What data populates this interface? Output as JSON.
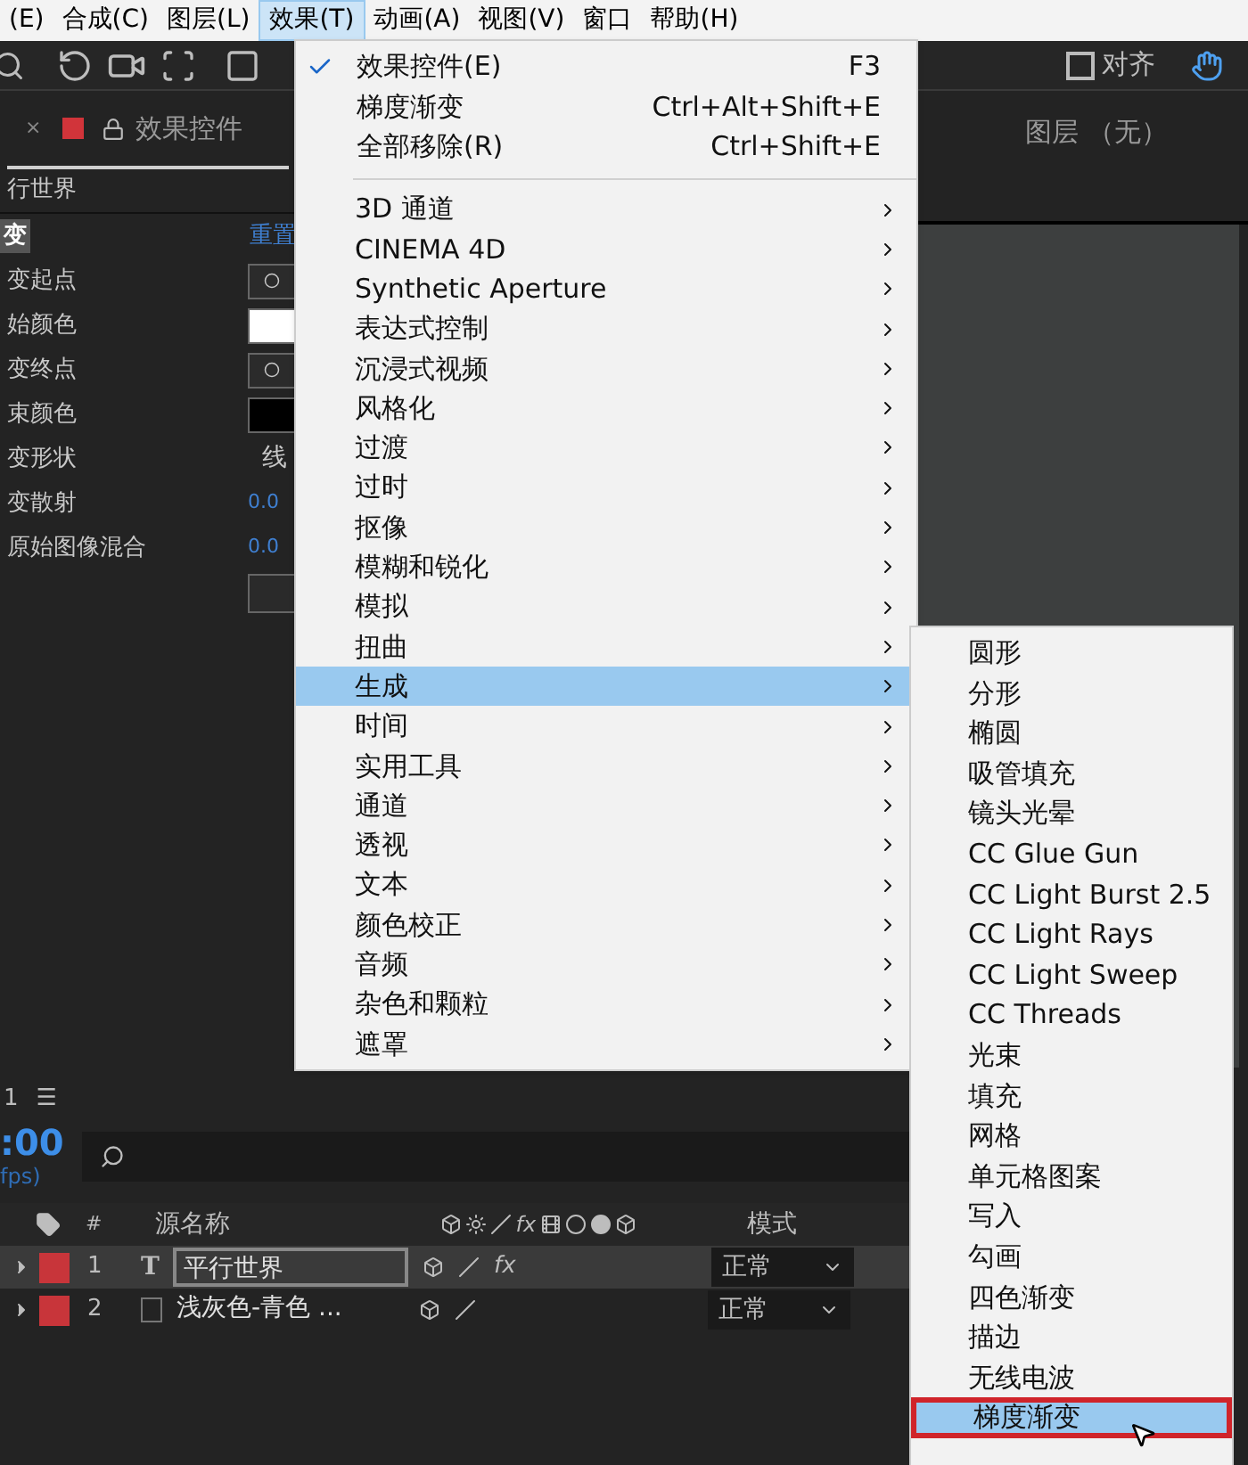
{
  "menubar": [
    {
      "label": "(E)",
      "selected": false
    },
    {
      "label": "合成(C)",
      "selected": false
    },
    {
      "label": "图层(L)",
      "selected": false
    },
    {
      "label": "效果(T)",
      "selected": true
    },
    {
      "label": "动画(A)",
      "selected": false
    },
    {
      "label": "视图(V)",
      "selected": false
    },
    {
      "label": "窗口",
      "selected": false
    },
    {
      "label": "帮助(H)",
      "selected": false
    }
  ],
  "toolbar": {
    "align_label": "对齐",
    "align_checked": false
  },
  "effect_panel": {
    "close_glyph": "×",
    "tab_label": "效果控件",
    "layer_name": "行世界",
    "effect_name": "变",
    "reset_label": "重置",
    "properties": [
      {
        "label": "变起点",
        "kind": "point"
      },
      {
        "label": "始颜色",
        "kind": "color",
        "color": "#ffffff"
      },
      {
        "label": "变终点",
        "kind": "point"
      },
      {
        "label": "束颜色",
        "kind": "color",
        "color": "#000000"
      },
      {
        "label": "变形状",
        "kind": "text",
        "value": "线"
      },
      {
        "label": "变散射",
        "kind": "number",
        "value": "0.0"
      },
      {
        "label": "原始图像混合",
        "kind": "number",
        "value": "0.0"
      },
      {
        "kind": "button"
      }
    ]
  },
  "right_panel": {
    "title": "图层 （无）"
  },
  "timeline": {
    "fx_header": "fx",
    "tab_label": "1",
    "menu_glyph": "☰",
    "timecode": ":00",
    "fps": "fps)",
    "hash_label": "#",
    "name_label": "源名称",
    "mode_label": "模式",
    "layers": [
      {
        "number": "1",
        "kind": "text",
        "type_glyph": "T",
        "fx_label": "fx",
        "name": "平行世界",
        "mode": "正常",
        "color": "#c8353a",
        "selected": true
      },
      {
        "number": "2",
        "kind": "solid",
        "name": "浅灰色-青色 ...",
        "mode": "正常",
        "color": "#c8353a",
        "selected": false
      }
    ]
  },
  "effects_menu": {
    "top_items": [
      {
        "label": "效果控件(E)",
        "shortcut": "F3",
        "checked": true
      },
      {
        "label": "梯度渐变",
        "shortcut": "Ctrl+Alt+Shift+E",
        "checked": false
      },
      {
        "label": "全部移除(R)",
        "shortcut": "Ctrl+Shift+E",
        "checked": false
      }
    ],
    "categories": [
      {
        "label": "3D 通道",
        "selected": false
      },
      {
        "label": "CINEMA 4D",
        "selected": false
      },
      {
        "label": "Synthetic Aperture",
        "selected": false
      },
      {
        "label": "表达式控制",
        "selected": false
      },
      {
        "label": "沉浸式视频",
        "selected": false
      },
      {
        "label": "风格化",
        "selected": false
      },
      {
        "label": "过渡",
        "selected": false
      },
      {
        "label": "过时",
        "selected": false
      },
      {
        "label": "抠像",
        "selected": false
      },
      {
        "label": "模糊和锐化",
        "selected": false
      },
      {
        "label": "模拟",
        "selected": false
      },
      {
        "label": "扭曲",
        "selected": false
      },
      {
        "label": "生成",
        "selected": true
      },
      {
        "label": "时间",
        "selected": false
      },
      {
        "label": "实用工具",
        "selected": false
      },
      {
        "label": "通道",
        "selected": false
      },
      {
        "label": "透视",
        "selected": false
      },
      {
        "label": "文本",
        "selected": false
      },
      {
        "label": "颜色校正",
        "selected": false
      },
      {
        "label": "音频",
        "selected": false
      },
      {
        "label": "杂色和颗粒",
        "selected": false
      },
      {
        "label": "遮罩",
        "selected": false
      }
    ]
  },
  "submenu": {
    "items": [
      {
        "label": "圆形",
        "selected": false
      },
      {
        "label": "分形",
        "selected": false
      },
      {
        "label": "椭圆",
        "selected": false
      },
      {
        "label": "吸管填充",
        "selected": false
      },
      {
        "label": "镜头光晕",
        "selected": false
      },
      {
        "label": "CC Glue Gun",
        "selected": false
      },
      {
        "label": "CC Light Burst 2.5",
        "selected": false
      },
      {
        "label": "CC Light Rays",
        "selected": false
      },
      {
        "label": "CC Light Sweep",
        "selected": false
      },
      {
        "label": "CC Threads",
        "selected": false
      },
      {
        "label": "光束",
        "selected": false
      },
      {
        "label": "填充",
        "selected": false
      },
      {
        "label": "网格",
        "selected": false
      },
      {
        "label": "单元格图案",
        "selected": false
      },
      {
        "label": "写入",
        "selected": false
      },
      {
        "label": "勾画",
        "selected": false
      },
      {
        "label": "四色渐变",
        "selected": false
      },
      {
        "label": "描边",
        "selected": false
      },
      {
        "label": "无线电波",
        "selected": false
      },
      {
        "label": "梯度渐变",
        "selected": true
      }
    ]
  }
}
